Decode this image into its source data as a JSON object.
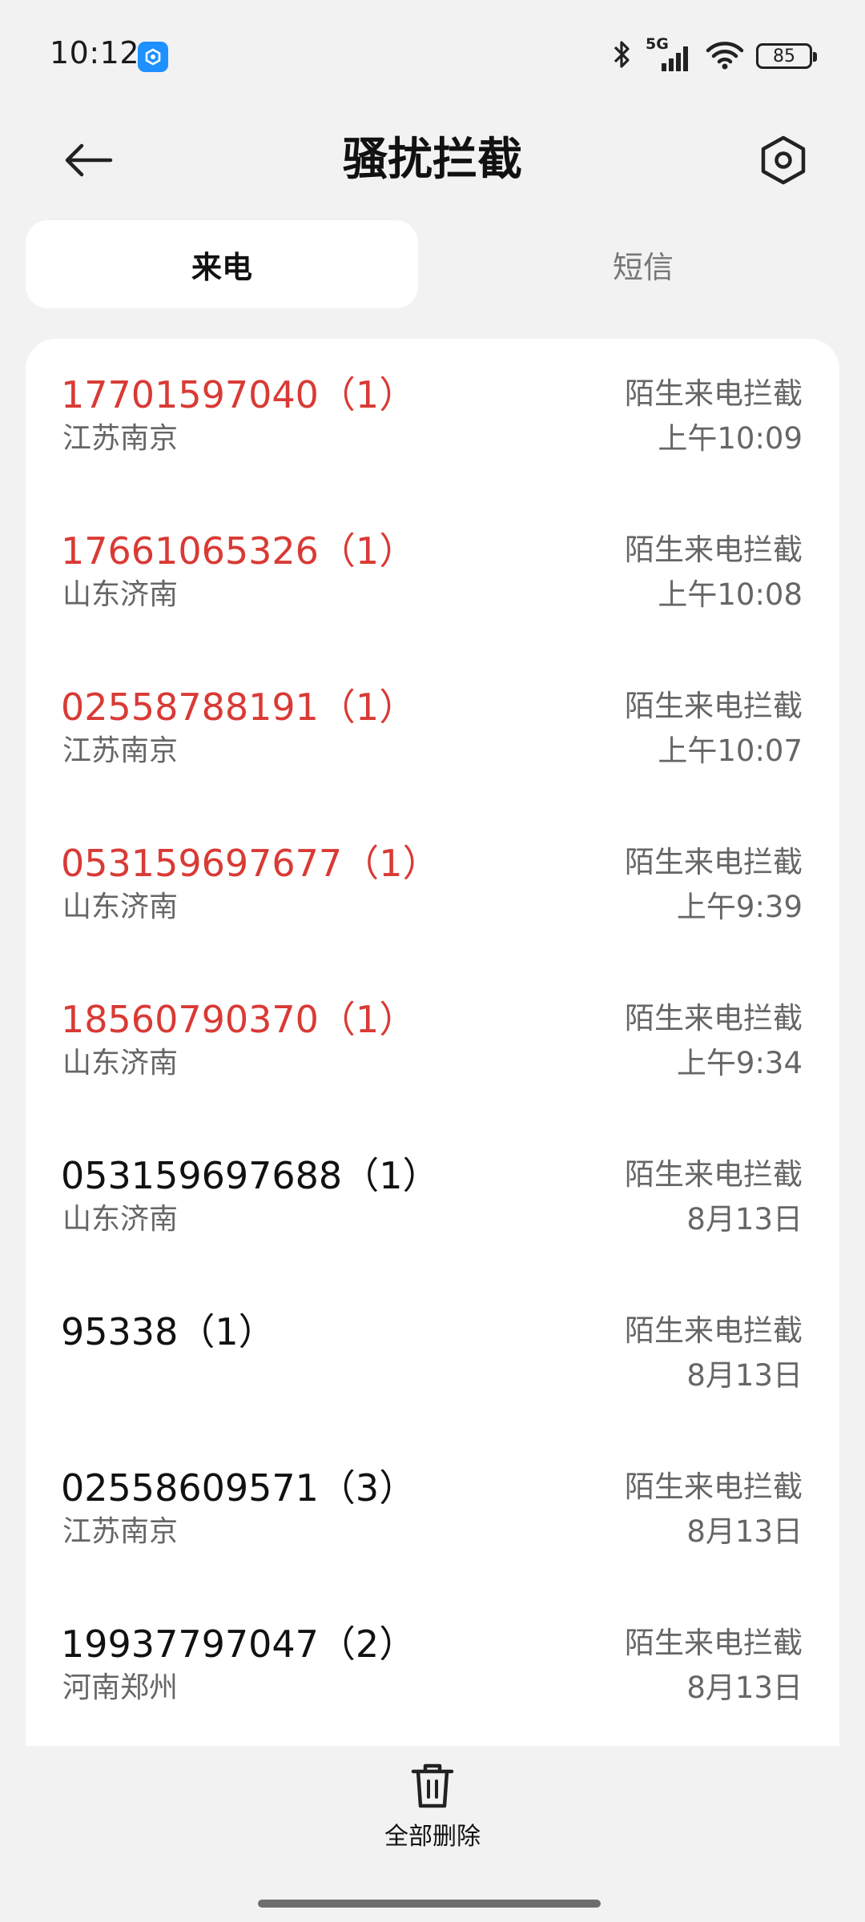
{
  "status_bar": {
    "time": "10:12",
    "network": "5G",
    "battery": "85",
    "icons": [
      "app-notification-icon",
      "bluetooth-icon",
      "signal-icon",
      "wifi-icon",
      "battery-icon"
    ]
  },
  "header": {
    "title": "骚扰拦截",
    "back_icon": "back-arrow-icon",
    "settings_icon": "settings-icon"
  },
  "tabs": [
    {
      "label": "来电",
      "active": true
    },
    {
      "label": "短信",
      "active": false
    }
  ],
  "calls": [
    {
      "number": "17701597040（1）",
      "location": "江苏南京",
      "type": "陌生来电拦截",
      "time": "上午10:09",
      "highlight": true
    },
    {
      "number": "17661065326（1）",
      "location": "山东济南",
      "type": "陌生来电拦截",
      "time": "上午10:08",
      "highlight": true
    },
    {
      "number": "02558788191（1）",
      "location": "江苏南京",
      "type": "陌生来电拦截",
      "time": "上午10:07",
      "highlight": true
    },
    {
      "number": "053159697677（1）",
      "location": "山东济南",
      "type": "陌生来电拦截",
      "time": "上午9:39",
      "highlight": true
    },
    {
      "number": "18560790370（1）",
      "location": "山东济南",
      "type": "陌生来电拦截",
      "time": "上午9:34",
      "highlight": true
    },
    {
      "number": "053159697688（1）",
      "location": "山东济南",
      "type": "陌生来电拦截",
      "time": "8月13日",
      "highlight": false
    },
    {
      "number": "95338（1）",
      "location": "",
      "type": "陌生来电拦截",
      "time": "8月13日",
      "highlight": false
    },
    {
      "number": "02558609571（3）",
      "location": "江苏南京",
      "type": "陌生来电拦截",
      "time": "8月13日",
      "highlight": false
    },
    {
      "number": "19937797047（2）",
      "location": "河南郑州",
      "type": "陌生来电拦截",
      "time": "8月13日",
      "highlight": false
    }
  ],
  "bottom": {
    "delete_all_label": "全部删除",
    "delete_icon": "trash-icon"
  },
  "colors": {
    "highlight": "#d93a35",
    "background": "#f2f2f2",
    "card": "#ffffff"
  }
}
